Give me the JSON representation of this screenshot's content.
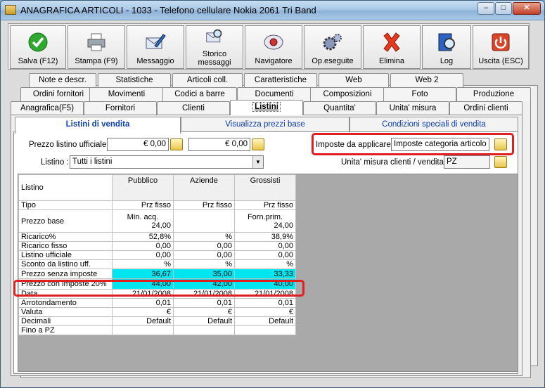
{
  "window": {
    "title": "ANAGRAFICA ARTICOLI - 1033 - Telefono cellulare Nokia 2061 Tri Band",
    "btn_min": "‒",
    "btn_max": "□",
    "btn_close": "✕"
  },
  "toolbar": [
    {
      "label": "Salva (F12)",
      "icon": "check-icon"
    },
    {
      "label": "Stampa (F9)",
      "icon": "printer-icon"
    },
    {
      "label": "Messaggio",
      "icon": "envelope-pen-icon"
    },
    {
      "label": "Storico\nmessaggi",
      "icon": "envelope-search-icon"
    },
    {
      "label": "Navigatore",
      "icon": "navigator-icon"
    },
    {
      "label": "Op.eseguite",
      "icon": "gears-icon"
    },
    {
      "label": "Elimina",
      "icon": "delete-x-icon"
    },
    {
      "label": "Log",
      "icon": "log-book-icon"
    },
    {
      "label": "Uscita (ESC)",
      "icon": "power-icon"
    }
  ],
  "tabs_row1": [
    "Note e descr.",
    "Statistiche",
    "Articoli coll.",
    "Caratteristiche",
    "Web",
    "Web 2"
  ],
  "tabs_row2": [
    "Ordini fornitori",
    "Movimenti",
    "Codici a barre",
    "Documenti",
    "Composizioni",
    "Foto",
    "Produzione"
  ],
  "tabs_row3": [
    "Anagrafica(F5)",
    "Fornitori",
    "Clienti",
    "Listini",
    "Quantita'",
    "Unita' misura",
    "Ordini clienti"
  ],
  "subtabs": [
    "Listini di vendita",
    "Visualizza prezzi base",
    "Condizioni speciali di vendita"
  ],
  "form": {
    "prezzo_label": "Prezzo listino ufficiale :",
    "prezzo_value1": "€ 0,00",
    "prezzo_value2": "€ 0,00",
    "imposte_label": "Imposte da applicare :",
    "imposte_value": "Imposte categoria articolo",
    "listino_label": "Listino :",
    "listino_value": "Tutti i listini",
    "um_label": "Unita' misura clienti / vendita :",
    "um_value": "PZ"
  },
  "grid": {
    "header": {
      "label": "Listino",
      "cols": [
        "Pubblico",
        "Aziende",
        "Grossisti"
      ]
    },
    "rows": [
      {
        "label": "Tipo",
        "v": [
          "Prz fisso",
          "Prz fisso",
          "Prz fisso"
        ]
      },
      {
        "label": "Prezzo base",
        "top": [
          "Min. acq.",
          "",
          "Forn.prim."
        ],
        "v": [
          "24,00",
          "",
          "24,00"
        ]
      },
      {
        "label": "Ricarico%",
        "v": [
          "52,8%",
          "%",
          "38,9%"
        ]
      },
      {
        "label": "Ricarico fisso",
        "v": [
          "0,00",
          "0,00",
          "0,00"
        ]
      },
      {
        "label": "Listino ufficiale",
        "v": [
          "0,00",
          "0,00",
          "0,00"
        ]
      },
      {
        "label": "Sconto da listino uff.",
        "v": [
          "%",
          "%",
          "%"
        ]
      },
      {
        "label": "Prezzo senza imposte",
        "v": [
          "36,67",
          "35,00",
          "33,33"
        ],
        "cyan": true
      },
      {
        "label": "Prezzo con imposte 20%",
        "v": [
          "44,00",
          "42,00",
          "40,00"
        ],
        "cyan": true
      },
      {
        "label": "Data",
        "v": [
          "21/01/2008",
          "21/01/2008",
          "21/01/2008"
        ]
      },
      {
        "label": "Arrotondamento",
        "v": [
          "0,01",
          "0,01",
          "0,01"
        ]
      },
      {
        "label": "Valuta",
        "v": [
          "€",
          "€",
          "€"
        ]
      },
      {
        "label": "Decimali",
        "v": [
          "Default",
          "Default",
          "Default"
        ]
      },
      {
        "label": "Fino a PZ",
        "v": [
          "",
          "",
          ""
        ]
      }
    ]
  },
  "colors": {
    "cyan": "#00e5f0",
    "highlight": "#e02020",
    "subtab_text": "#0a3cb4"
  }
}
